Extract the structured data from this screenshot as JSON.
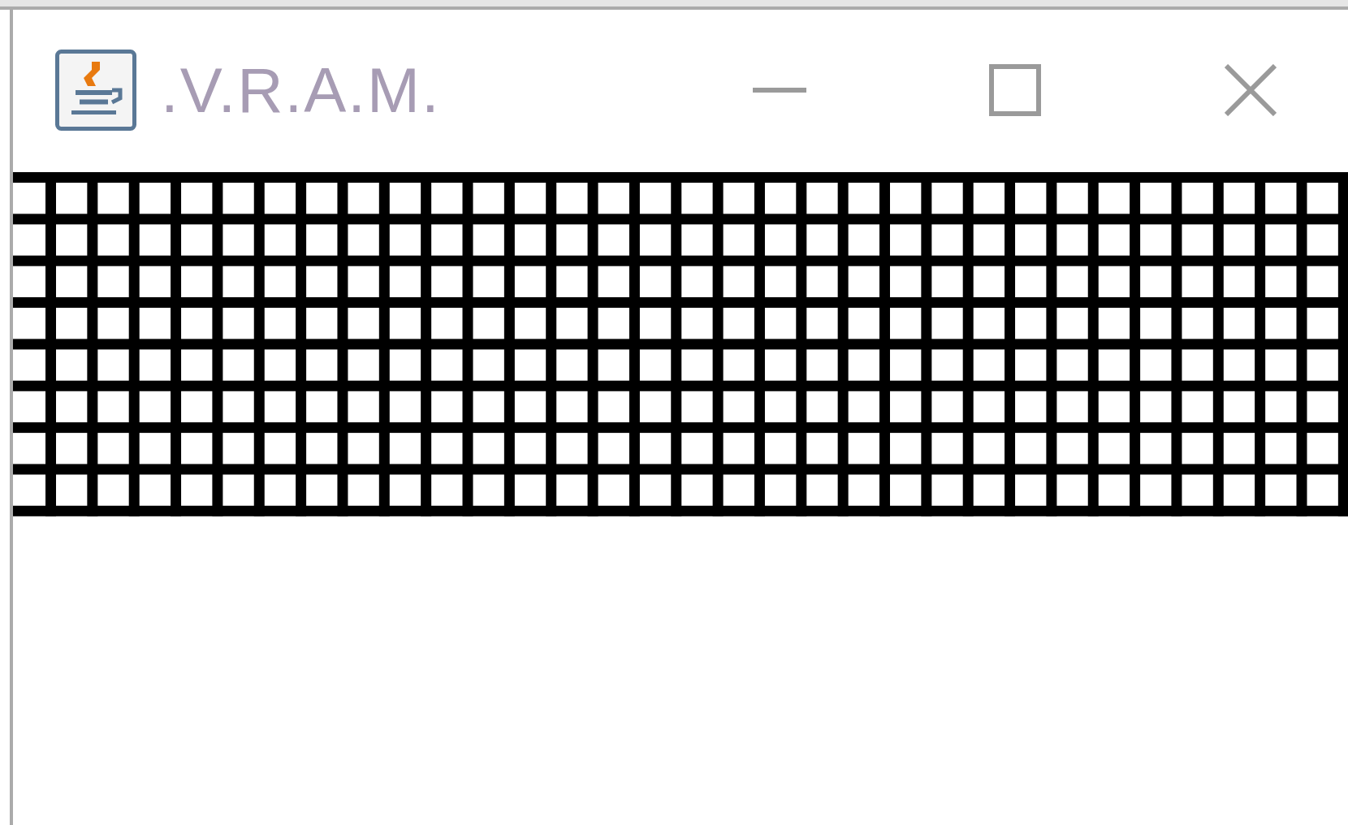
{
  "window": {
    "title": ".V.R.A.M."
  }
}
